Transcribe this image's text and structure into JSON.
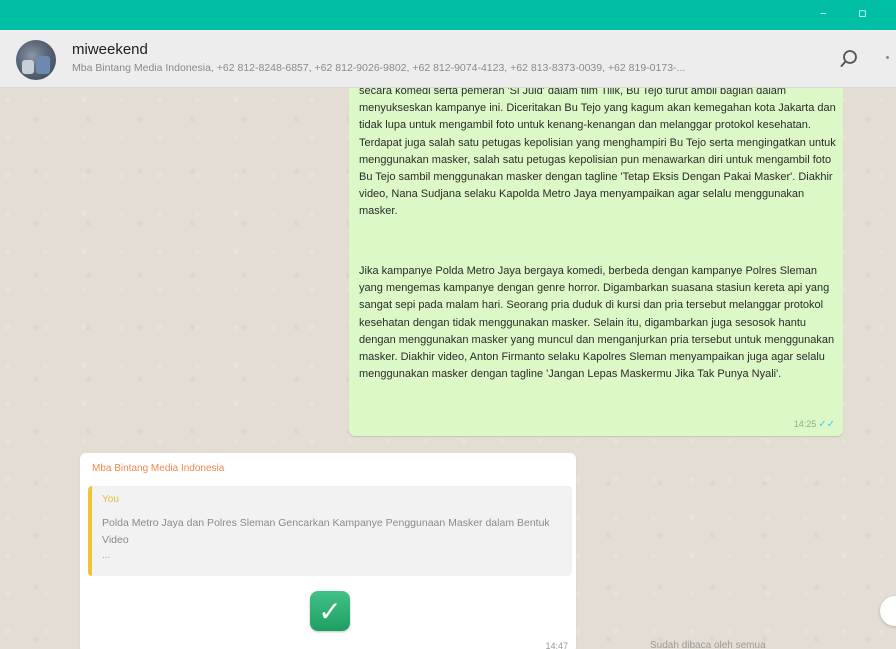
{
  "window": {
    "minimize_glyph": "–",
    "maximize_glyph": "▫",
    "accent": "#00bfa5"
  },
  "header": {
    "chat_name": "miweekend",
    "participants": "Mba Bintang Media Indonesia, +62 812-8248-6857, +62 812-9026-9802, +62 812-9074-4123, +62 813-8373-0039, +62 819-0173-...",
    "search_icon": "search-icon"
  },
  "messages": {
    "outgoing": {
      "paragraph_1": "secara komedi serta pemeran 'Si Juid' dalam film Tilik, Bu Tejo turut ambil bagian dalam menyukseskan kampanye ini. Diceritakan Bu Tejo yang kagum akan kemegahan kota Jakarta dan tidak lupa untuk mengambil foto untuk kenang-kenangan dan melanggar protokol kesehatan. Terdapat juga salah satu petugas kepolisian yang menghampiri Bu Tejo serta mengingatkan untuk menggunakan masker, salah satu petugas kepolisian pun menawarkan diri untuk mengambil foto Bu Tejo sambil menggunakan masker dengan tagline 'Tetap Eksis Dengan Pakai Masker'. Diakhir video, Nana Sudjana selaku Kapolda Metro Jaya menyampaikan agar selalu menggunakan masker.",
      "paragraph_2": "Jika kampanye Polda Metro Jaya bergaya komedi, berbeda dengan kampanye Polres Sleman yang mengemas kampanye dengan genre horror. Digambarkan suasana stasiun kereta api yang sangat sepi pada malam hari. Seorang pria duduk di kursi dan pria tersebut melanggar protokol kesehatan dengan tidak menggunakan masker. Selain itu, digambarkan juga sesosok hantu dengan menggunakan masker yang muncul dan menganjurkan pria tersebut untuk menggunakan masker. Diakhir video, Anton Firmanto selaku Kapolres Sleman menyampaikan juga agar selalu menggunakan masker dengan tagline 'Jangan Lepas Maskermu Jika Tak Punya Nyali'.",
      "time": "14:25",
      "tick": "✓✓"
    },
    "incoming": {
      "sender": "Mba Bintang Media Indonesia",
      "quote_name": "You",
      "quote_text": "Polda Metro Jaya dan Polres Sleman Gencarkan Kampanye Penggunaan Masker dalam Bentuk Video",
      "quote_more": "...",
      "check_glyph": "✓",
      "time": "14:47"
    }
  },
  "footer_note": "Sudah dibaca oleh semua"
}
